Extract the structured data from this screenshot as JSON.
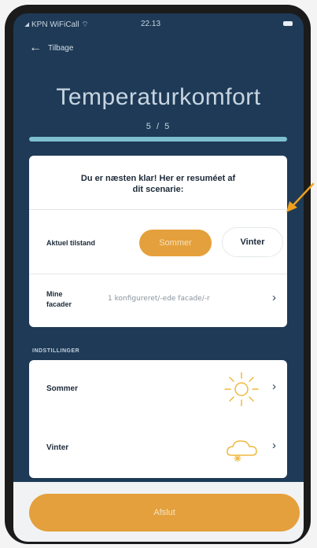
{
  "status_bar": {
    "carrier": "KPN WiFiCall",
    "time": "22.13"
  },
  "nav": {
    "back_label": "Tilbage"
  },
  "header": {
    "title": "Temperaturkomfort",
    "step": "5 / 5",
    "progress": 1.0
  },
  "summary": {
    "intro_line1": "Du er næsten klar! Her er resuméet af",
    "intro_line2": "dit scenarie:",
    "state_label": "Aktuel tilstand",
    "option_summer": "Sommer",
    "option_winter": "Vinter",
    "selected": "Sommer",
    "facades_label_line1": "Mine",
    "facades_label_line2": "facader",
    "facades_value": "1 konfigureret/-ede facade/-r"
  },
  "settings": {
    "section_label": "INDSTILLINGER",
    "items": [
      {
        "label": "Sommer",
        "icon": "sun-icon"
      },
      {
        "label": "Vinter",
        "icon": "snow-cloud-icon"
      }
    ]
  },
  "footer": {
    "finish_label": "Afslut"
  },
  "colors": {
    "background": "#1e3a56",
    "accent": "#e4a03c",
    "progress": "#7ec0ce",
    "annotation": "#f0a01e"
  }
}
